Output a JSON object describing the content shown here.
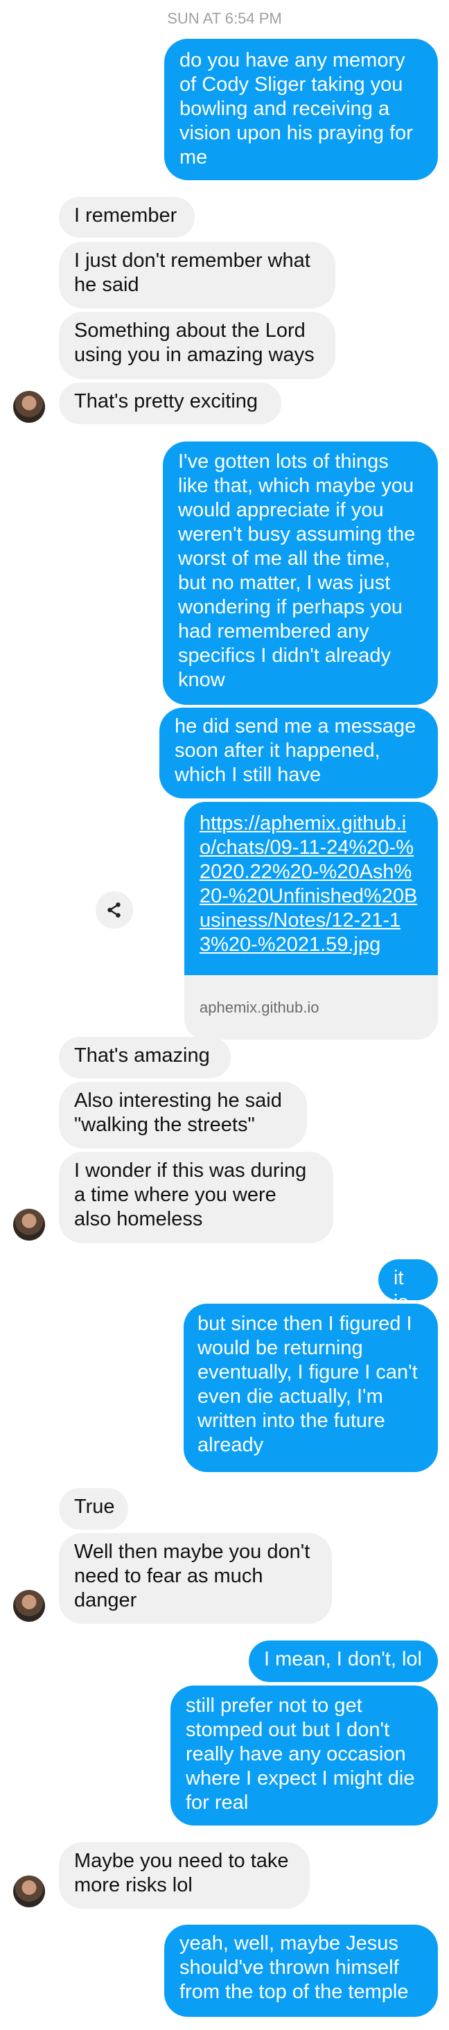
{
  "timestamp": "SUN AT 6:54 PM",
  "messages": [
    {
      "text": "do you have any memory of Cody Sliger taking you bowling and receiving a vision upon his praying for me"
    },
    {
      "text": "I remember"
    },
    {
      "text": "I just don't remember what he said"
    },
    {
      "text": "Something about the Lord using you in amazing ways"
    },
    {
      "text": "That's pretty exciting"
    },
    {
      "text": "I've gotten lots of things like that, which maybe you would appreciate if you weren't busy assuming the worst of me all the time, but no matter, I was just wondering if perhaps you had remembered any specifics I didn't already know"
    },
    {
      "text": "he did send me a message soon after it happened, which I still have"
    },
    {
      "text": "That's amazing"
    },
    {
      "text": "Also interesting he said \"walking the streets\""
    },
    {
      "text": "I wonder if this was during a time where you were also homeless"
    },
    {
      "text": "it is"
    },
    {
      "text": "but since then I figured I would be returning eventually, I figure I can't even die actually, I'm written into the future already"
    },
    {
      "text": "True"
    },
    {
      "text": "Well then maybe you don't need to fear as much danger"
    },
    {
      "text": "I mean, I don't, lol"
    },
    {
      "text": "still prefer not to get stomped out but I don't really have any occasion where I expect I might die for real"
    },
    {
      "text": "Maybe you need to take more risks lol"
    },
    {
      "text": "yeah, well, maybe Jesus should've thrown himself from the top of the temple"
    }
  ],
  "link": {
    "url": "https://aphemix.github.io/chats/09-11-24%20-%2020.22%20-%20Ash%20-%20Unfinished%20Business/Notes/12-21-13%20-%2021.59.jpg",
    "domain": "aphemix.github.io"
  },
  "icons": {
    "share": "share-icon",
    "avatar": "avatar"
  },
  "colors": {
    "sent": "#0a9ef5",
    "received": "#f1f0f0",
    "timestamp": "#a0a0a0"
  }
}
